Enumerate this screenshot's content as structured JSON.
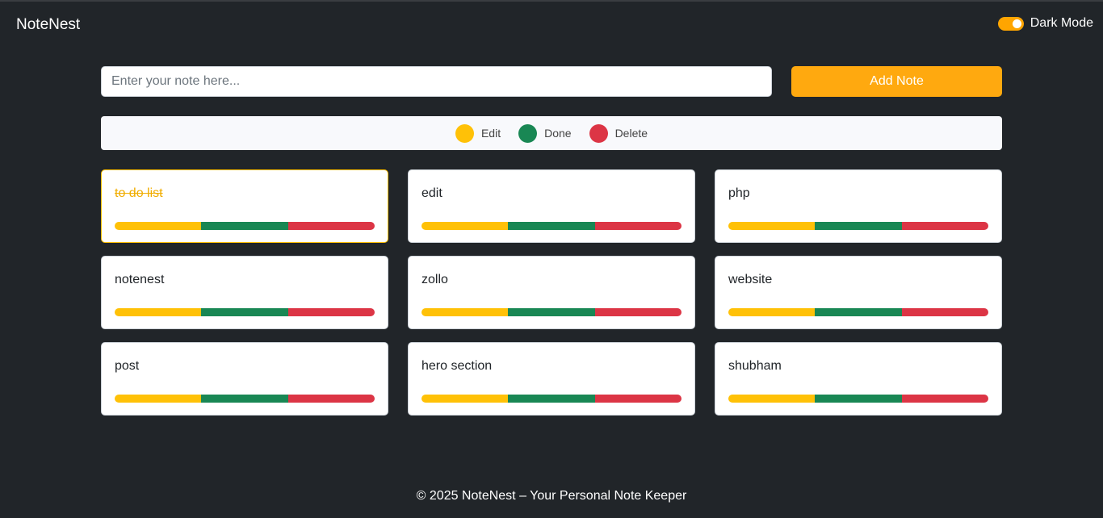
{
  "brand": "NoteNest",
  "dark_mode": {
    "label": "Dark Mode",
    "on": true
  },
  "input": {
    "placeholder": "Enter your note here...",
    "value": ""
  },
  "add_button": "Add Note",
  "colors": {
    "accent": "#ffa90f",
    "edit": "#ffc107",
    "done": "#198754",
    "delete": "#dc3545",
    "done_text": "#f0ad00"
  },
  "legend": [
    {
      "label": "Edit",
      "color": "#ffc107"
    },
    {
      "label": "Done",
      "color": "#198754"
    },
    {
      "label": "Delete",
      "color": "#dc3545"
    }
  ],
  "notes": [
    {
      "text": "to do list",
      "done": true
    },
    {
      "text": "edit",
      "done": false
    },
    {
      "text": "php",
      "done": false
    },
    {
      "text": "notenest",
      "done": false
    },
    {
      "text": "zollo",
      "done": false
    },
    {
      "text": "website",
      "done": false
    },
    {
      "text": "post",
      "done": false
    },
    {
      "text": "hero section",
      "done": false
    },
    {
      "text": "shubham",
      "done": false
    }
  ],
  "footer": "© 2025 NoteNest – Your Personal Note Keeper"
}
